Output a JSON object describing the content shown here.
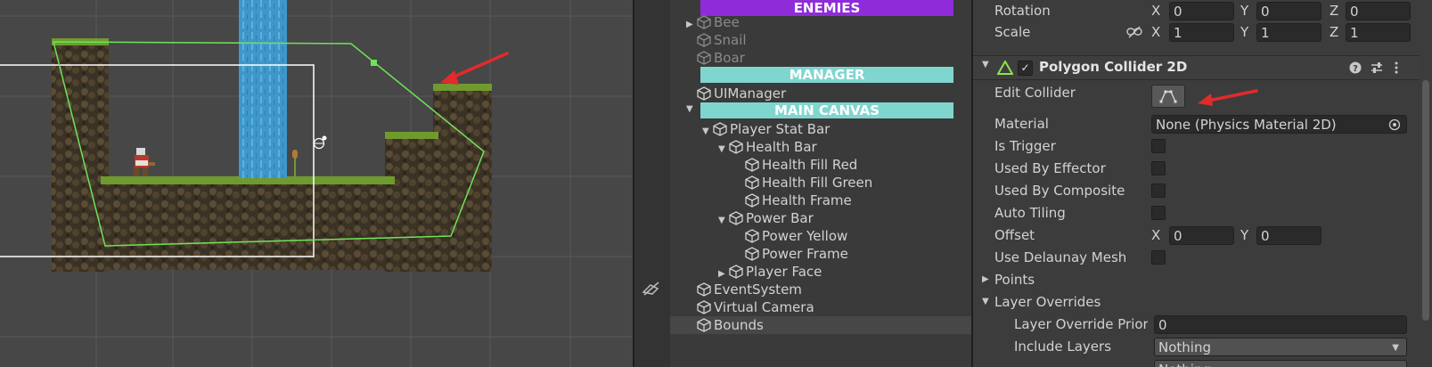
{
  "hierarchy": {
    "enemies_banner": "ENEMIES",
    "bee": "Bee",
    "snail": "Snail",
    "boar": "Boar",
    "manager_banner": "MANAGER",
    "ui_manager": "UIManager",
    "main_canvas_banner": "MAIN CANVAS",
    "player_stat_bar": "Player Stat Bar",
    "health_bar": "Health Bar",
    "health_fill_red": "Health Fill Red",
    "health_fill_green": "Health Fill Green",
    "health_frame": "Health Frame",
    "power_bar": "Power Bar",
    "power_yellow": "Power Yellow",
    "power_frame": "Power Frame",
    "player_face": "Player Face",
    "event_system": "EventSystem",
    "virtual_camera": "Virtual Camera",
    "bounds": "Bounds",
    "colors": {
      "enemies": "#8f2bd9",
      "manager": "#7fd6cf",
      "main_canvas": "#7fd6cf"
    }
  },
  "inspector": {
    "rotation_label": "Rotation",
    "rotation": {
      "x": "0",
      "y": "0",
      "z": "0"
    },
    "scale_label": "Scale",
    "scale": {
      "x": "1",
      "y": "1",
      "z": "1"
    },
    "axis_x": "X",
    "axis_y": "Y",
    "axis_z": "Z",
    "component_title": "Polygon Collider 2D",
    "component_enabled": true,
    "edit_collider_label": "Edit Collider",
    "material_label": "Material",
    "material_value": "None (Physics Material 2D)",
    "is_trigger_label": "Is Trigger",
    "used_by_effector_label": "Used By Effector",
    "used_by_composite_label": "Used By Composite",
    "auto_tiling_label": "Auto Tiling",
    "offset_label": "Offset",
    "offset": {
      "x": "0",
      "y": "0"
    },
    "use_delaunay_label": "Use Delaunay Mesh",
    "points_label": "Points",
    "layer_overrides_label": "Layer Overrides",
    "layer_override_priority_label": "Layer Override Priori",
    "layer_override_priority_value": "0",
    "include_layers_label": "Include Layers",
    "include_layers_value": "Nothing",
    "exclude_layers_value": "Nothing"
  },
  "icons": [
    "cube-icon",
    "collider-icon",
    "help-icon",
    "presets-icon",
    "menu-icon",
    "link-icon",
    "edit-collider-icon",
    "target-icon",
    "annotation-arrow"
  ],
  "accent_colors": {
    "collider_outline": "#6fe35a",
    "annotation": "#e02b2b"
  }
}
